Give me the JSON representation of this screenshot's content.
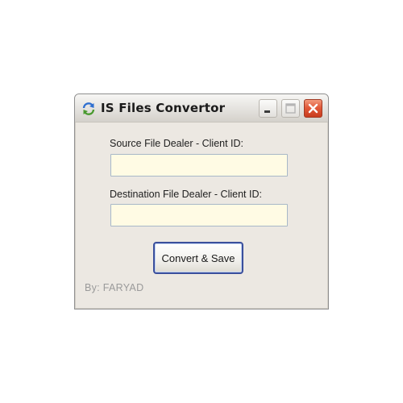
{
  "window": {
    "title": "IS Files Convertor",
    "icon": "refresh-arrows-icon",
    "controls": {
      "minimize_icon": "minimize-icon",
      "maximize_icon": "maximize-icon",
      "close_icon": "close-icon"
    }
  },
  "form": {
    "source_label": "Source File Dealer - Client ID:",
    "source_value": "",
    "destination_label": "Destination File Dealer - Client ID:",
    "destination_value": "",
    "convert_button_label": "Convert & Save"
  },
  "footer": {
    "by_text": "By:  FARYAD"
  },
  "colors": {
    "window_background": "#ece8e2",
    "input_background": "#fffbe4",
    "close_button": "#e25a3a",
    "button_border": "#3a4f9c",
    "footer_text": "#9a9a9a"
  }
}
